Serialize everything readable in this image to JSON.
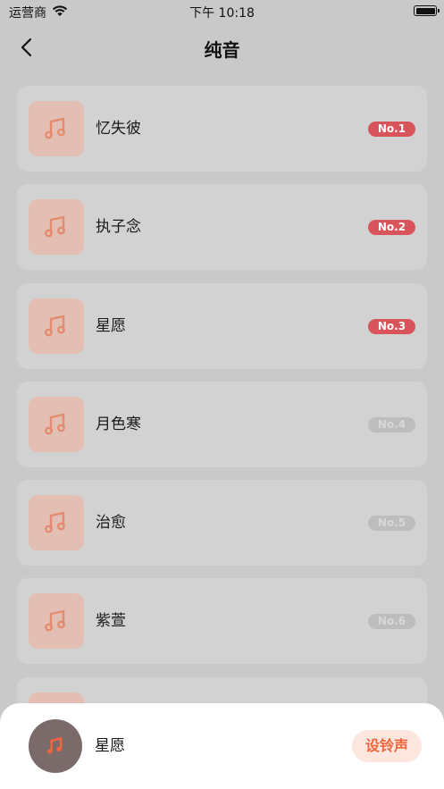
{
  "status_bar": {
    "carrier": "运营商",
    "time": "下午 10:18"
  },
  "nav": {
    "title": "纯音"
  },
  "items": [
    {
      "name": "忆失彼",
      "rank": "No.1"
    },
    {
      "name": "执子念",
      "rank": "No.2"
    },
    {
      "name": "星愿",
      "rank": "No.3"
    },
    {
      "name": "月色寒",
      "rank": "No.4"
    },
    {
      "name": "治愈",
      "rank": "No.5"
    },
    {
      "name": "紫萱",
      "rank": "No.6"
    },
    {
      "name": "",
      "rank": ""
    }
  ],
  "player": {
    "song": "星愿",
    "set_ringtone": "设铃声"
  },
  "colors": {
    "accent": "#f0653e",
    "top_rank": "#d8535a",
    "thumb": "#e3bfb3"
  },
  "icons": {
    "note": "music-note-icon",
    "back": "back-chevron-icon"
  }
}
